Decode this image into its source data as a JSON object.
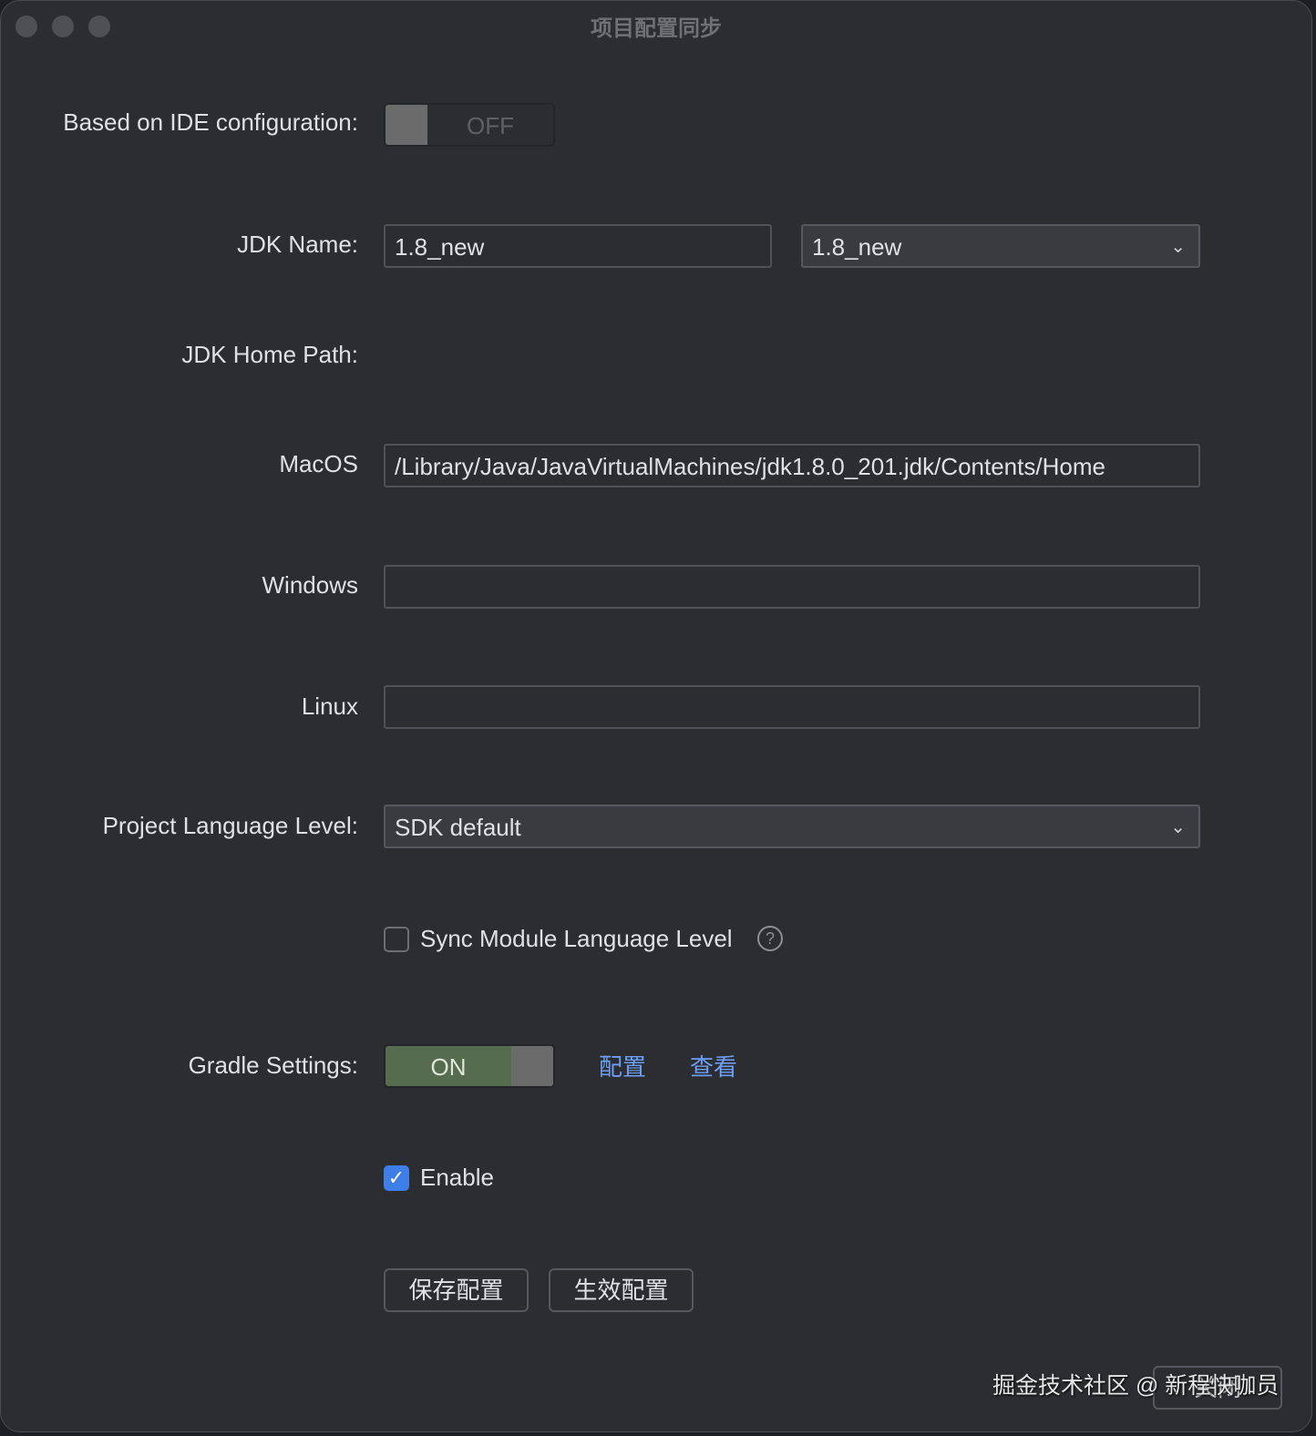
{
  "window": {
    "title": "项目配置同步"
  },
  "ide_config": {
    "label": "Based on IDE configuration:",
    "toggle": "OFF"
  },
  "jdk_name": {
    "label": "JDK Name:",
    "value": "1.8_new",
    "select": "1.8_new"
  },
  "jdk_home": {
    "label": "JDK Home Path:"
  },
  "macos": {
    "label": "MacOS",
    "value": "/Library/Java/JavaVirtualMachines/jdk1.8.0_201.jdk/Contents/Home"
  },
  "windows": {
    "label": "Windows",
    "value": ""
  },
  "linux": {
    "label": "Linux",
    "value": ""
  },
  "language_level": {
    "label": "Project Language Level:",
    "value": "SDK default"
  },
  "sync_module": {
    "label": "Sync Module Language Level",
    "checked": false
  },
  "gradle": {
    "label": "Gradle Settings:",
    "toggle": "ON",
    "link_config": "配置",
    "link_view": "查看"
  },
  "enable": {
    "label": "Enable",
    "checked": true
  },
  "buttons": {
    "save": "保存配置",
    "apply": "生效配置",
    "close": "关闭"
  },
  "watermark": "掘金技术社区 @ 新程快咖员"
}
